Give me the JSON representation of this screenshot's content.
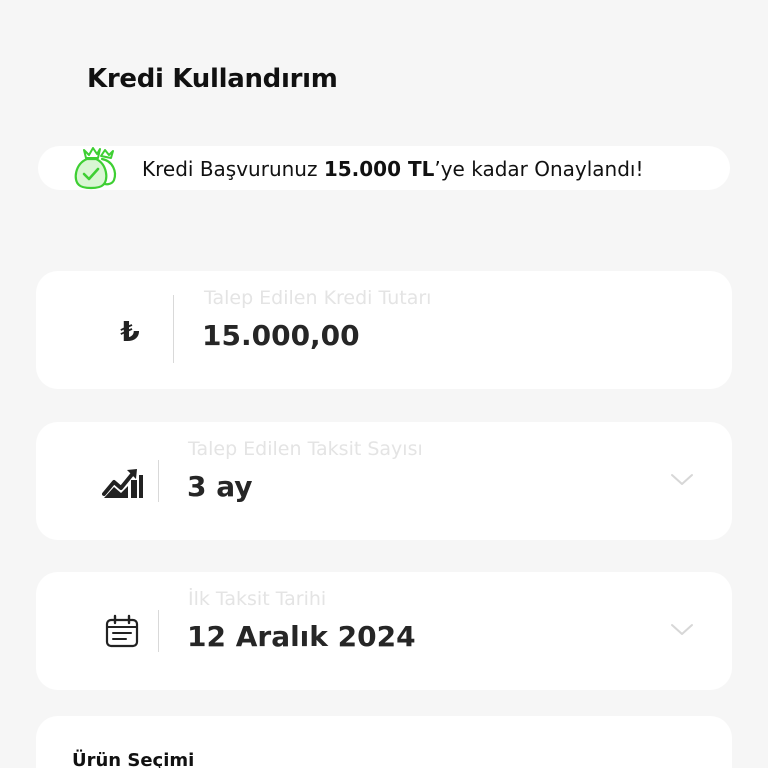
{
  "header": {
    "title": "Kredi Kullandırım"
  },
  "banner": {
    "text_prefix": "Kredi Başvurunuz ",
    "text_amount": "15.000 TL",
    "text_suffix": "’ye kadar Onaylandı!",
    "icon": "money-bags-approved-icon",
    "accent_color": "#3ecf33"
  },
  "amount_field": {
    "label": "Talep Edilen Kredi Tutarı",
    "value": "15.000,00",
    "currency_symbol": "₺"
  },
  "installment_field": {
    "label": "Talep Edilen Taksit Sayısı",
    "value": "3 ay",
    "icon": "growth-chart-icon"
  },
  "first_installment_field": {
    "label": "İlk Taksit Tarihi",
    "value": "12 Aralık 2024",
    "icon": "calendar-icon"
  },
  "product_section": {
    "title": "Ürün Seçimi"
  }
}
